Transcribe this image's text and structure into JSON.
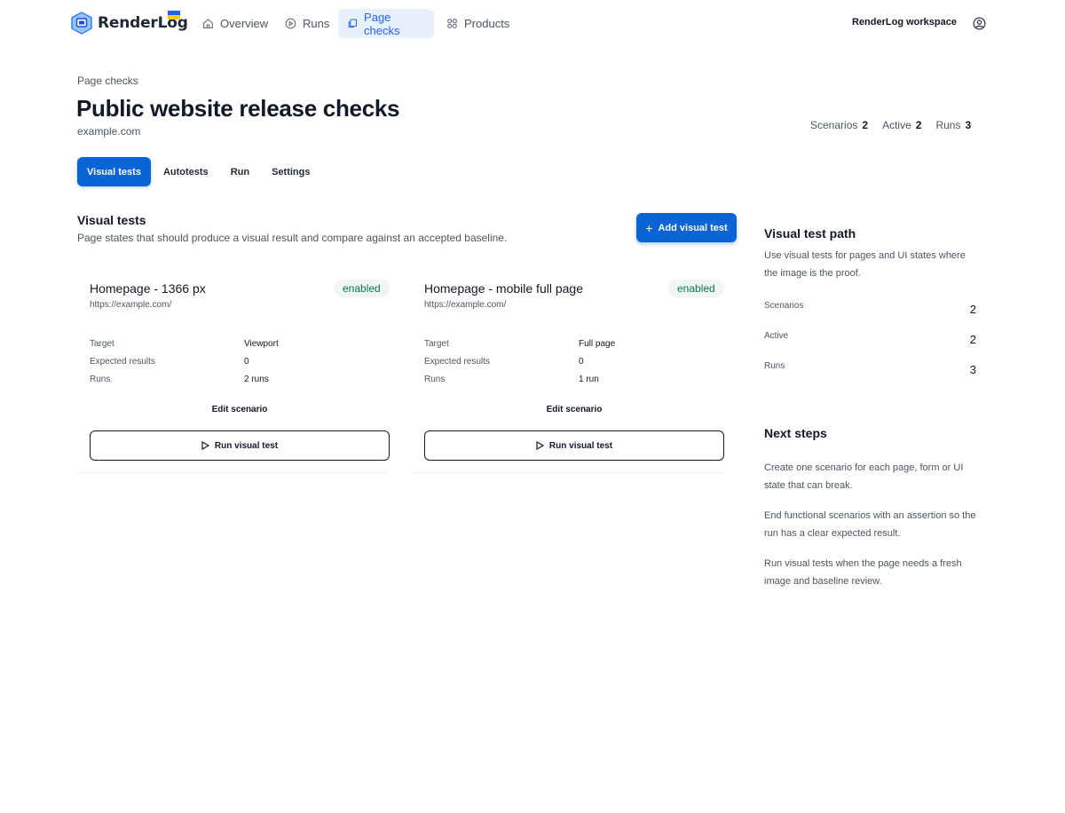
{
  "nav": {
    "brand": "RenderLog",
    "items": [
      {
        "label": "Overview",
        "icon": "home-icon"
      },
      {
        "label": "Runs",
        "icon": "play-circle-icon"
      },
      {
        "label": "Page checks",
        "icon": "pages-icon"
      },
      {
        "label": "Products",
        "icon": "grid-icon"
      }
    ],
    "active": "Page checks",
    "workspace": "RenderLog workspace"
  },
  "header": {
    "breadcrumb": "Page checks",
    "title": "Public website release checks",
    "domain": "example.com",
    "stats": [
      {
        "label": "Scenarios",
        "value": "2"
      },
      {
        "label": "Active",
        "value": "2"
      },
      {
        "label": "Runs",
        "value": "3"
      }
    ]
  },
  "tabs": [
    "Visual tests",
    "Autotests",
    "Run",
    "Settings"
  ],
  "section": {
    "title": "Visual tests",
    "description": "Page states that should produce a visual result and compare against an accepted baseline.",
    "add_button": "Add visual test"
  },
  "cards": [
    {
      "title": "Homepage - 1366 px",
      "badge": "enabled",
      "url": "https://example.com/",
      "rows": [
        {
          "key": "Target",
          "value": "Viewport"
        },
        {
          "key": "Expected results",
          "value": "0"
        },
        {
          "key": "Runs",
          "value": "2 runs"
        }
      ],
      "edit": "Edit scenario",
      "run": "Run visual test"
    },
    {
      "title": "Homepage - mobile full page",
      "badge": "enabled",
      "url": "https://example.com/",
      "rows": [
        {
          "key": "Target",
          "value": "Full page"
        },
        {
          "key": "Expected results",
          "value": "0"
        },
        {
          "key": "Runs",
          "value": "1 run"
        }
      ],
      "edit": "Edit scenario",
      "run": "Run visual test"
    }
  ],
  "sidebar": {
    "path_title": "Visual test path",
    "path_text": "Use visual tests for pages and UI states where the image is the proof.",
    "metrics": [
      {
        "key": "Scenarios",
        "value": "2"
      },
      {
        "key": "Active",
        "value": "2"
      },
      {
        "key": "Runs",
        "value": "3"
      }
    ],
    "next_title": "Next steps",
    "steps": [
      "Create one scenario for each page, form or UI state that can break.",
      "End functional scenarios with an assertion so the run has a clear expected result.",
      "Run visual tests when the page needs a fresh image and baseline review."
    ]
  },
  "colors": {
    "accent": "#0b64d6",
    "nav_active_bg": "#e8f0fb",
    "badge_text": "#047857",
    "badge_bg": "#f1f5f3"
  }
}
